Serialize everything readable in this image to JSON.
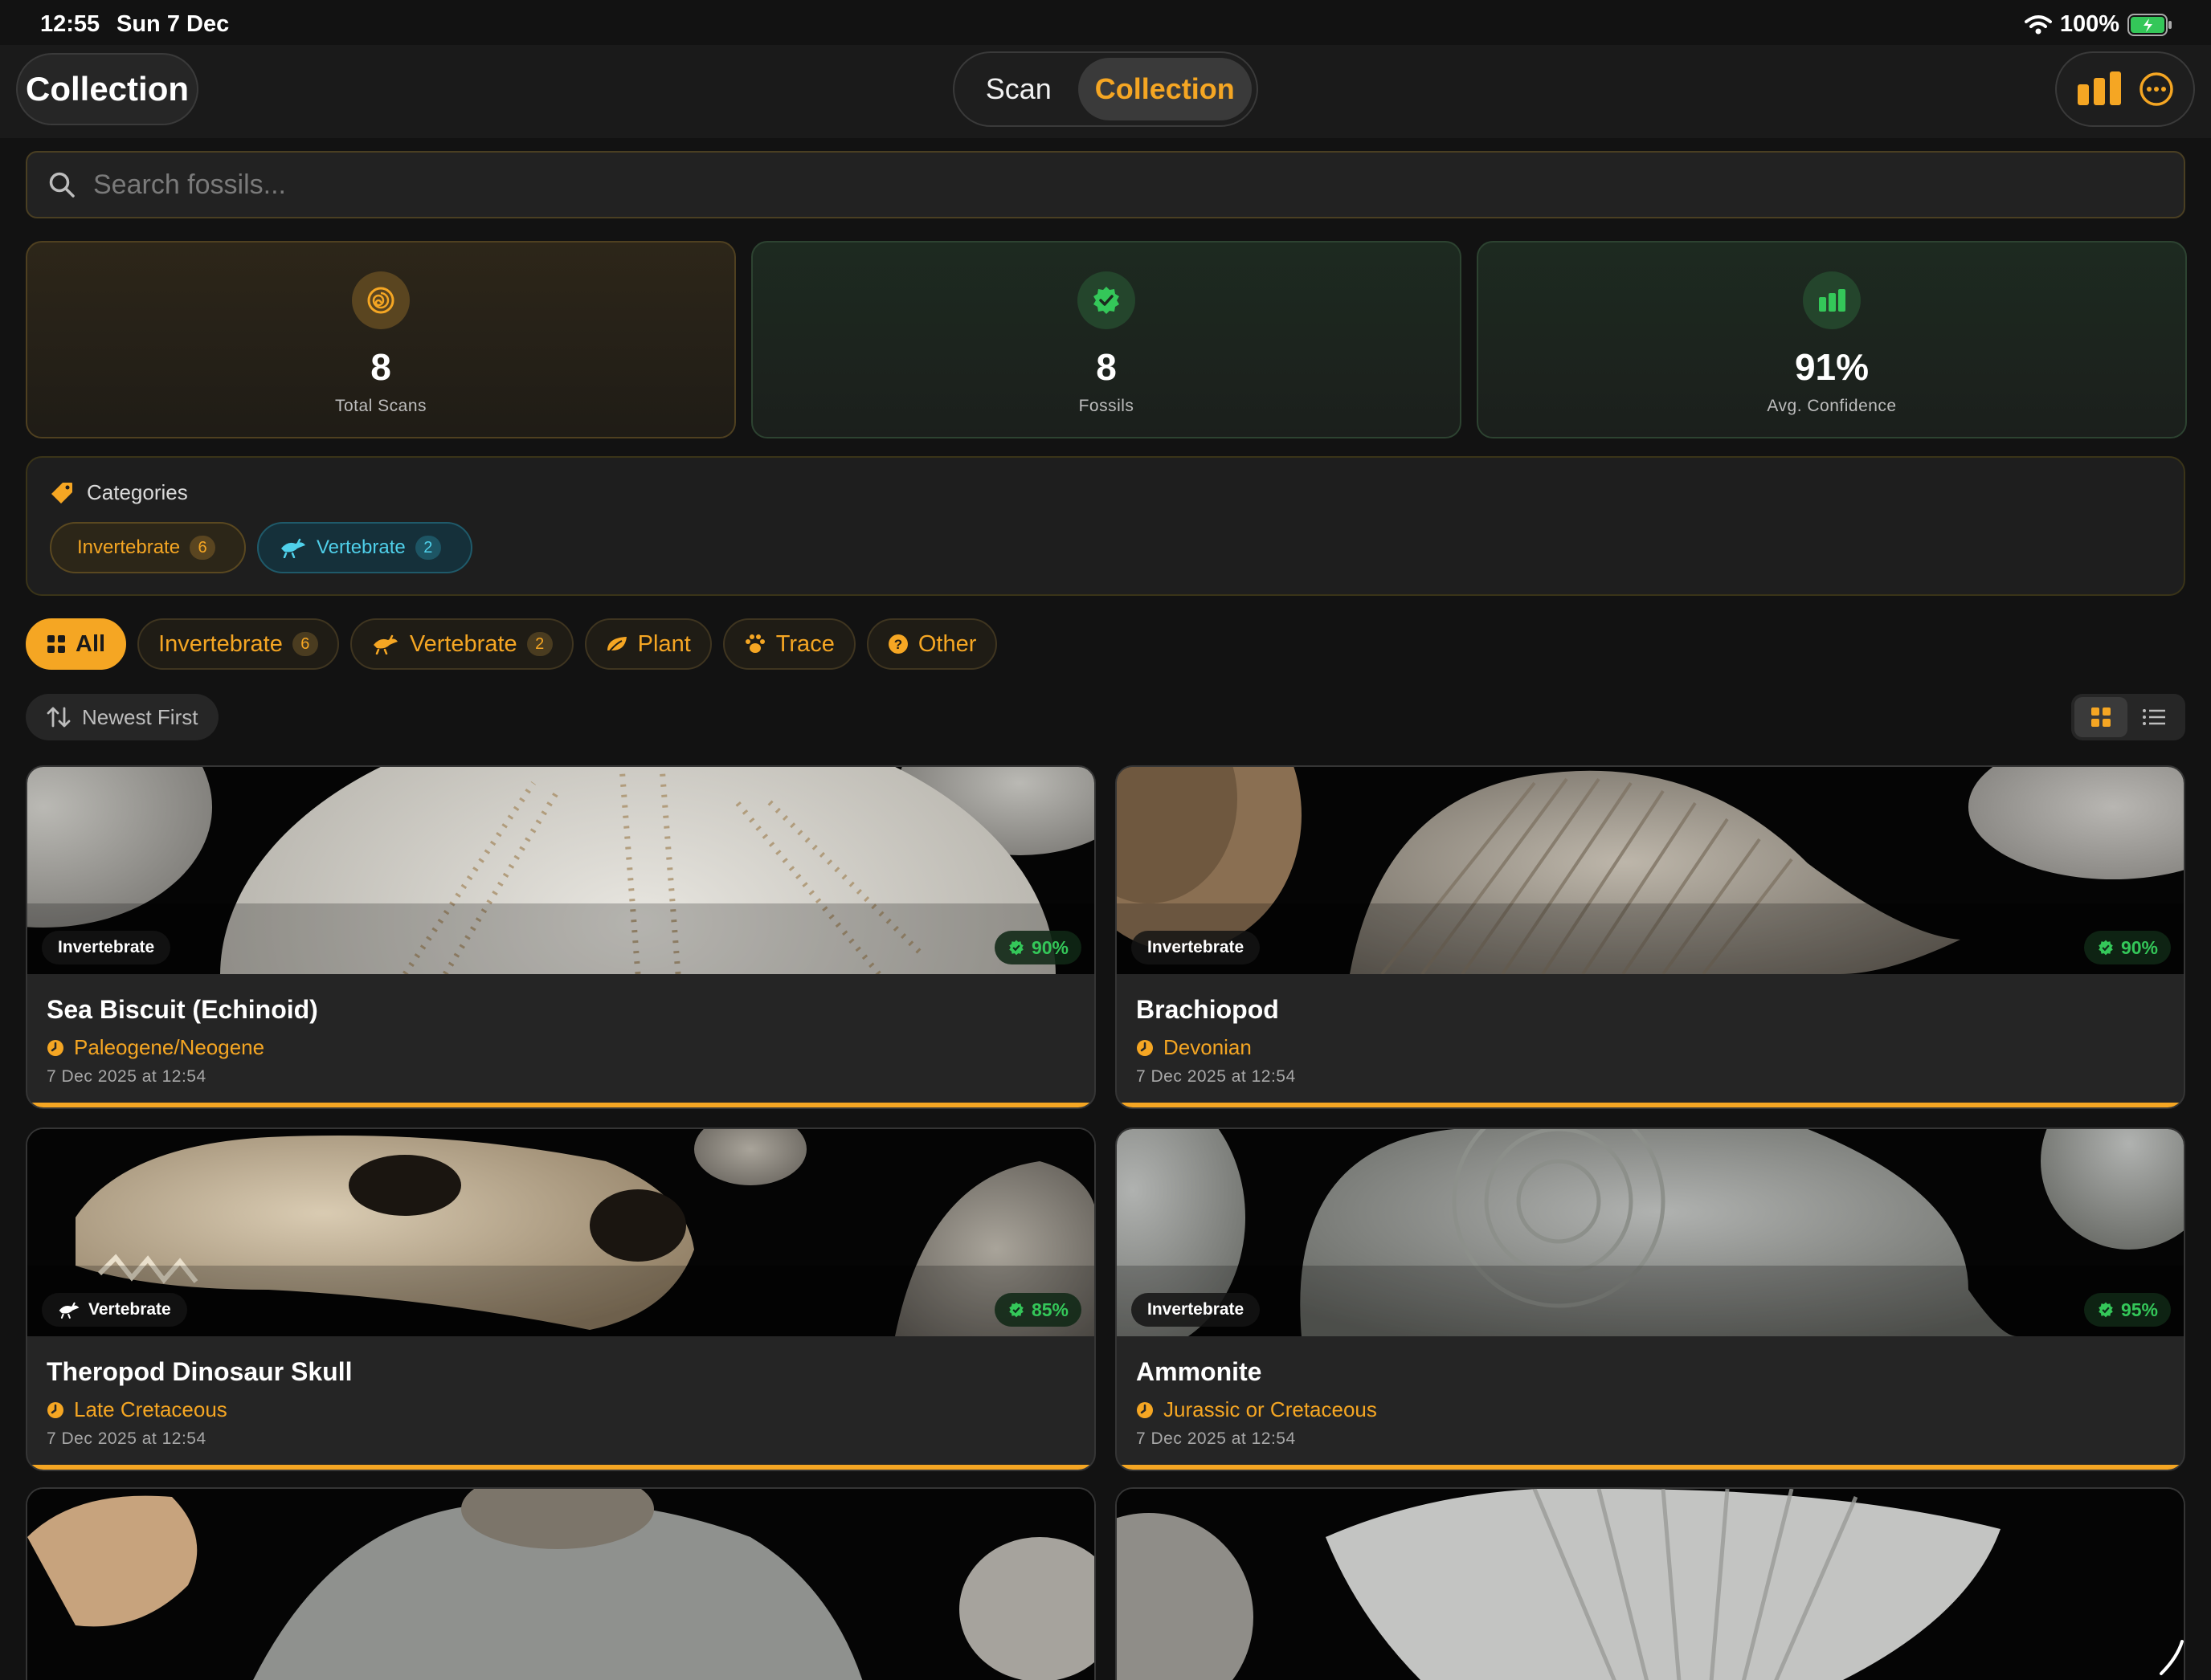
{
  "status": {
    "time": "12:55",
    "date": "Sun 7 Dec",
    "battery": "100%"
  },
  "nav": {
    "title": "Collection",
    "segments": [
      "Scan",
      "Collection"
    ]
  },
  "search": {
    "placeholder": "Search fossils..."
  },
  "stats": [
    {
      "value": "8",
      "label": "Total Scans",
      "icon": "ammonite-icon"
    },
    {
      "value": "8",
      "label": "Fossils",
      "icon": "verified-badge-icon"
    },
    {
      "value": "91%",
      "label": "Avg. Confidence",
      "icon": "bar-chart-icon"
    }
  ],
  "categories": {
    "title": "Categories",
    "chips": [
      {
        "label": "Invertebrate",
        "count": "6"
      },
      {
        "label": "Vertebrate",
        "count": "2"
      }
    ]
  },
  "filters": [
    {
      "label": "All",
      "count": null
    },
    {
      "label": "Invertebrate",
      "count": "6"
    },
    {
      "label": "Vertebrate",
      "count": "2"
    },
    {
      "label": "Plant",
      "count": null
    },
    {
      "label": "Trace",
      "count": null
    },
    {
      "label": "Other",
      "count": null
    }
  ],
  "sort": {
    "label": "Newest First"
  },
  "cards": [
    {
      "tag": "Invertebrate",
      "confidence": "90%",
      "name": "Sea Biscuit (Echinoid)",
      "era": "Paleogene/Neogene",
      "date": "7 Dec 2025 at 12:54"
    },
    {
      "tag": "Invertebrate",
      "confidence": "90%",
      "name": "Brachiopod",
      "era": "Devonian",
      "date": "7 Dec 2025 at 12:54"
    },
    {
      "tag": "Vertebrate",
      "confidence": "85%",
      "name": "Theropod Dinosaur Skull",
      "era": "Late Cretaceous",
      "date": "7 Dec 2025 at 12:54"
    },
    {
      "tag": "Invertebrate",
      "confidence": "95%",
      "name": "Ammonite",
      "era": "Jurassic or Cretaceous",
      "date": "7 Dec 2025 at 12:54"
    }
  ],
  "colors": {
    "accent": "#f5a623",
    "success": "#34c759",
    "vertebrate": "#4fd0ea",
    "background": "#121212"
  }
}
